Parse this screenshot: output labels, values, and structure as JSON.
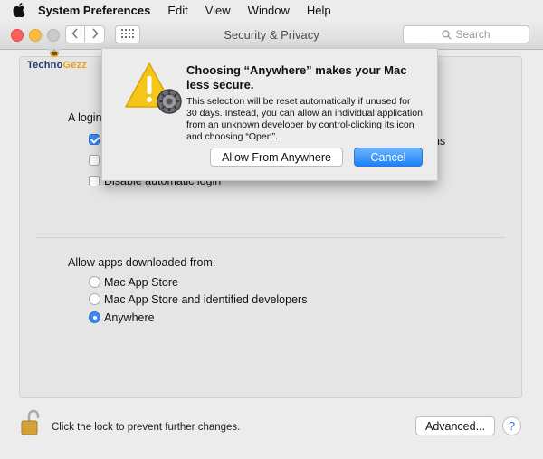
{
  "menubar": {
    "apple_icon": "apple-logo-icon",
    "app_name": "System Preferences",
    "items": [
      "Edit",
      "View",
      "Window",
      "Help"
    ]
  },
  "window": {
    "title": "Security & Privacy",
    "search_placeholder": "Search"
  },
  "logo": {
    "part1": "Techno",
    "part2": "Gezz"
  },
  "login_section": {
    "heading": "A login",
    "trailing_text": "ons",
    "option3": "Disable automatic login",
    "checkbox1_checked": true
  },
  "apps_section": {
    "heading": "Allow apps downloaded from:",
    "options": [
      "Mac App Store",
      "Mac App Store and identified developers",
      "Anywhere"
    ],
    "selected": "Anywhere"
  },
  "bottom": {
    "lock_text": "Click the lock to prevent further changes.",
    "advanced_label": "Advanced...",
    "help_label": "?"
  },
  "sheet": {
    "title": "Choosing “Anywhere” makes your Mac less secure.",
    "body": "This selection will be reset automatically if unused for 30 days. Instead, you can allow an individual application from an unknown developer by control-clicking its icon and choosing “Open”.",
    "allow_label": "Allow From Anywhere",
    "cancel_label": "Cancel"
  },
  "colors": {
    "accent": "#1a82fb",
    "close": "#fc605c",
    "minimize": "#fdbc40",
    "warning": "#f5c518"
  }
}
